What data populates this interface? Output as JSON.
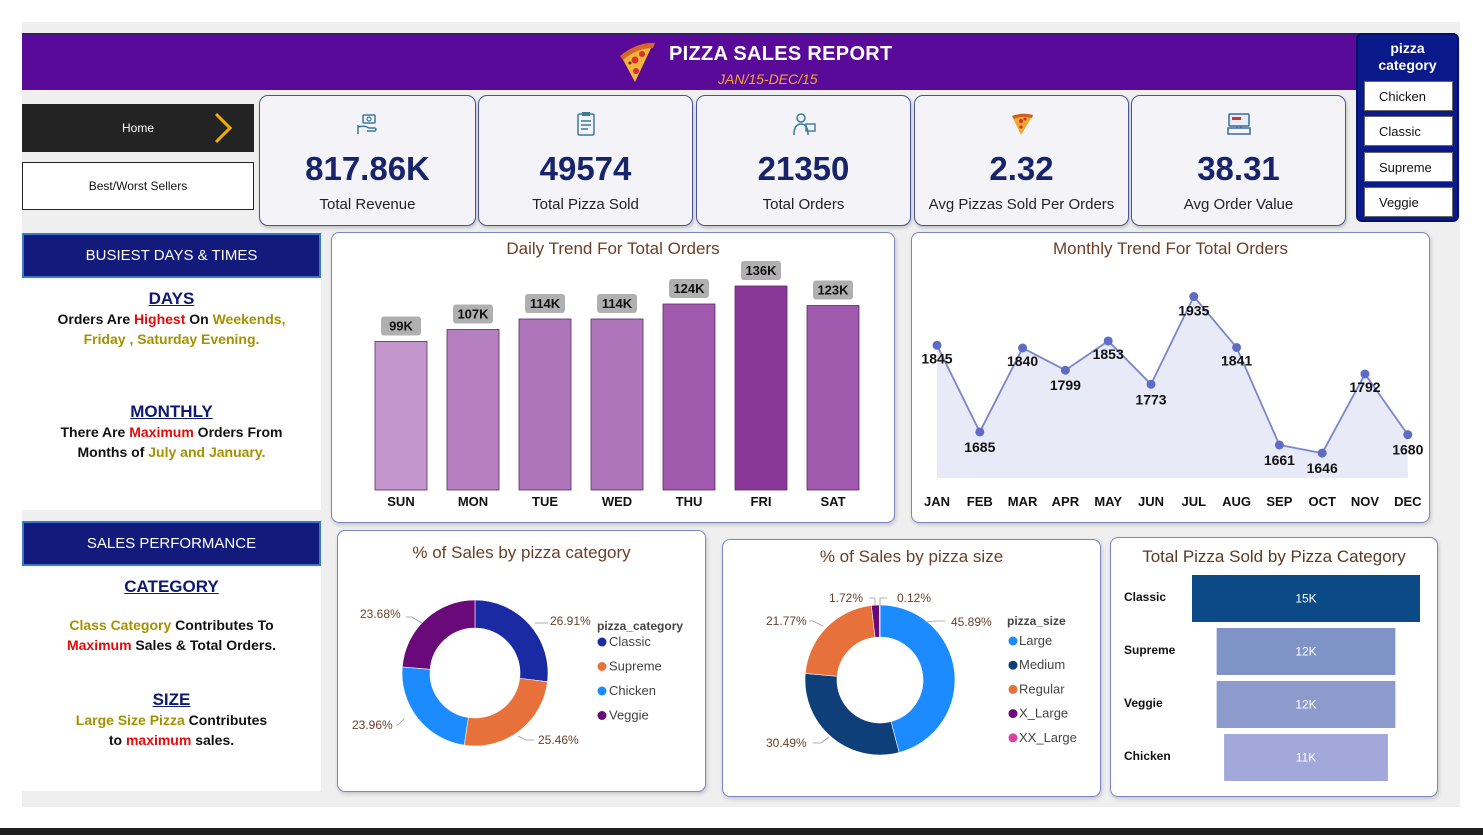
{
  "header": {
    "title": "PIZZA SALES REPORT",
    "subtitle": "JAN/15-DEC/15",
    "icon": "pizza-icon"
  },
  "nav": {
    "home_label": "Home",
    "best_worst_label": "Best/Worst Sellers"
  },
  "kpis": [
    {
      "value": "817.86K",
      "label": "Total Revenue",
      "icon": "money-hand-icon"
    },
    {
      "value": "49574",
      "label": "Total Pizza Sold",
      "icon": "clipboard-icon"
    },
    {
      "value": "21350",
      "label": "Total Orders",
      "icon": "delivery-person-icon"
    },
    {
      "value": "2.32",
      "label": "Avg Pizzas Sold Per Orders",
      "icon": "pizza-slice-icon"
    },
    {
      "value": "38.31",
      "label": "Avg Order Value",
      "icon": "cash-register-icon"
    }
  ],
  "slicer": {
    "title_line1": "pizza",
    "title_line2": "category",
    "options": [
      "Chicken",
      "Classic",
      "Supreme",
      "Veggie"
    ]
  },
  "busiest": {
    "heading": "BUSIEST DAYS & TIMES",
    "days_title": "DAYS",
    "days_line1_a": "Orders Are ",
    "days_line1_b": "Highest",
    "days_line1_c": " On ",
    "days_line1_d": "Weekends,",
    "days_line2": "Friday , Saturday Evening.",
    "monthly_title": "MONTHLY",
    "monthly_line1_a": "There Are ",
    "monthly_line1_b": "Maximum",
    "monthly_line1_c": " Orders From",
    "monthly_line2_a": "Months of ",
    "monthly_line2_b": "July and January."
  },
  "performance": {
    "heading": "SALES PERFORMANCE",
    "category_title": "CATEGORY",
    "cat_line1_a": "Class Category",
    "cat_line1_b": " Contributes To",
    "cat_line2_a": "Maximum",
    "cat_line2_b": " Sales & Total Orders.",
    "size_title": "SIZE",
    "size_line1_a": "Large Size Pizza",
    "size_line1_b": " Contributes",
    "size_line2_a": "to ",
    "size_line2_b": "maximum",
    "size_line2_c": " sales."
  },
  "chart_data": [
    {
      "type": "bar",
      "title": "Daily Trend For Total Orders",
      "categories": [
        "SUN",
        "MON",
        "TUE",
        "WED",
        "THU",
        "FRI",
        "SAT"
      ],
      "values": [
        99,
        107,
        114,
        114,
        124,
        136,
        123
      ],
      "labels": [
        "99K",
        "107K",
        "114K",
        "114K",
        "124K",
        "136K",
        "123K"
      ],
      "colors": [
        "#c497cc",
        "#b67fc0",
        "#ae75ba",
        "#ae75ba",
        "#9f5aae",
        "#8a3898",
        "#9f5aae"
      ],
      "ylim": [
        0,
        140
      ]
    },
    {
      "type": "area",
      "title": "Monthly Trend For Total Orders",
      "categories": [
        "JAN",
        "FEB",
        "MAR",
        "APR",
        "MAY",
        "JUN",
        "JUL",
        "AUG",
        "SEP",
        "OCT",
        "NOV",
        "DEC"
      ],
      "values": [
        1845,
        1685,
        1840,
        1799,
        1853,
        1773,
        1935,
        1841,
        1661,
        1646,
        1792,
        1680
      ],
      "ylim": [
        1600,
        1960
      ]
    },
    {
      "type": "pie",
      "title": "% of Sales by pizza category",
      "legend_title": "pizza_category",
      "slices": [
        {
          "name": "Classic",
          "value": 26.91,
          "label": "26.91%",
          "color": "#1a2aa3"
        },
        {
          "name": "Supreme",
          "value": 25.46,
          "label": "25.46%",
          "color": "#e8703a"
        },
        {
          "name": "Chicken",
          "value": 23.96,
          "label": "23.96%",
          "color": "#1b8bff"
        },
        {
          "name": "Veggie",
          "value": 23.68,
          "label": "23.68%",
          "color": "#6a0a7a"
        }
      ]
    },
    {
      "type": "pie",
      "title": "% of Sales by pizza size",
      "legend_title": "pizza_size",
      "slices": [
        {
          "name": "Large",
          "value": 45.89,
          "label": "45.89%",
          "color": "#1b8bff"
        },
        {
          "name": "Medium",
          "value": 30.49,
          "label": "30.49%",
          "color": "#0e3f78"
        },
        {
          "name": "Regular",
          "value": 21.77,
          "label": "21.77%",
          "color": "#e8703a"
        },
        {
          "name": "X_Large",
          "value": 1.72,
          "label": "1.72%",
          "color": "#6a0a7a"
        },
        {
          "name": "XX_Large",
          "value": 0.12,
          "label": "0.12%",
          "color": "#e040a0"
        }
      ]
    },
    {
      "type": "bar",
      "title": "Total Pizza Sold by Pizza Category",
      "categories": [
        "Classic",
        "Supreme",
        "Veggie",
        "Chicken"
      ],
      "values": [
        15,
        12,
        12,
        11
      ],
      "labels": [
        "15K",
        "12K",
        "12K",
        "11K"
      ],
      "colors": [
        "#0b4a86",
        "#7f93c6",
        "#8c9bcc",
        "#a3a8da"
      ],
      "xlim": [
        0,
        15
      ]
    }
  ]
}
